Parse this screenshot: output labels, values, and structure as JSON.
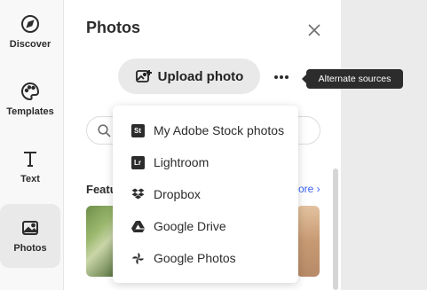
{
  "rail": {
    "items": [
      {
        "label": "Discover",
        "icon": "compass-icon"
      },
      {
        "label": "Templates",
        "icon": "palette-icon"
      },
      {
        "label": "Text",
        "icon": "text-icon"
      },
      {
        "label": "Photos",
        "icon": "image-icon",
        "active": true
      }
    ]
  },
  "panel": {
    "title": "Photos",
    "upload_label": "Upload photo",
    "section_label": "Featu",
    "see_more_label": "ore ›"
  },
  "tooltip": {
    "text": "Alternate sources"
  },
  "menu": {
    "items": [
      {
        "label": "My Adobe Stock photos",
        "icon": "adobe-stock-icon",
        "badge": "St"
      },
      {
        "label": "Lightroom",
        "icon": "lightroom-icon",
        "badge": "Lr"
      },
      {
        "label": "Dropbox",
        "icon": "dropbox-icon"
      },
      {
        "label": "Google Drive",
        "icon": "google-drive-icon"
      },
      {
        "label": "Google Photos",
        "icon": "google-photos-icon"
      }
    ]
  },
  "colors": {
    "accent": "#3b63fb",
    "tooltip_bg": "#2c2c2c"
  }
}
